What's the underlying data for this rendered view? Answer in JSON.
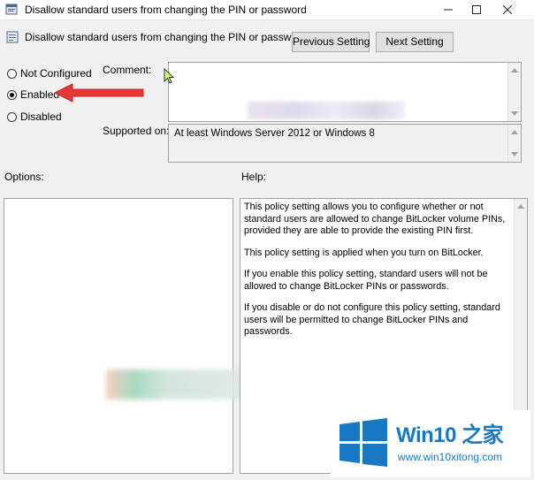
{
  "window": {
    "title": "Disallow standard users from changing the PIN or password",
    "icon": "policy-icon"
  },
  "header": {
    "title": "Disallow standard users from changing the PIN or password",
    "prev_label": "Previous Setting",
    "next_label": "Next Setting"
  },
  "state": {
    "options": [
      {
        "label": "Not Configured",
        "selected": false
      },
      {
        "label": "Enabled",
        "selected": true
      },
      {
        "label": "Disabled",
        "selected": false
      }
    ]
  },
  "labels": {
    "comment": "Comment:",
    "supported_on": "Supported on:",
    "options": "Options:",
    "help": "Help:"
  },
  "comment_value": "",
  "supported_on_value": "At least Windows Server 2012 or Windows 8",
  "help_paragraphs": [
    "This policy setting allows you to configure whether or not standard users are allowed to change BitLocker volume PINs, provided they are able to provide the existing PIN first.",
    "This policy setting is applied when you turn on BitLocker.",
    "If you enable this policy setting, standard users will not be allowed to change BitLocker PINs or passwords.",
    "If you disable or do not configure this policy setting, standard users will be permitted to change BitLocker PINs and passwords."
  ],
  "annotation": {
    "arrow_color": "#e53935"
  },
  "watermark": {
    "brand": "Win10 之家",
    "url": "www.win10xitong.com",
    "color": "#1a78c2"
  }
}
